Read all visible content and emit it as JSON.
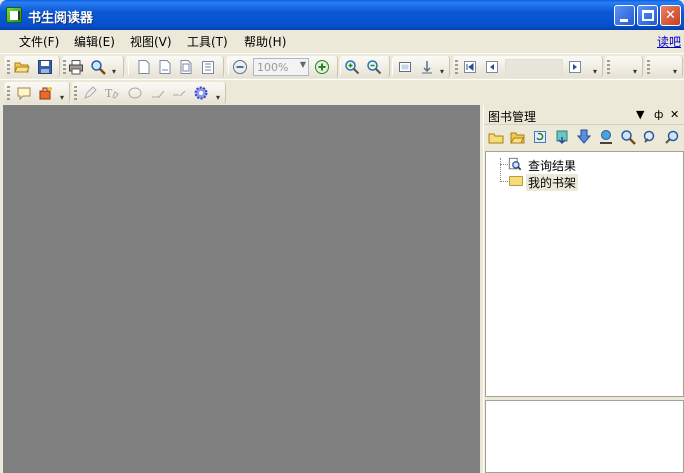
{
  "window": {
    "title": "书生阅读器",
    "controls": {
      "minimize": "",
      "maximize": "",
      "close": "✕"
    }
  },
  "menubar": {
    "items": [
      {
        "label": "文件(F)"
      },
      {
        "label": "编辑(E)"
      },
      {
        "label": "视图(V)"
      },
      {
        "label": "工具(T)"
      },
      {
        "label": "帮助(H)"
      }
    ],
    "right_link": "读吧"
  },
  "toolbar": {
    "zoom_value": "100%",
    "page_value": "",
    "icons": [
      "open-folder-icon",
      "save-icon",
      "print-icon",
      "find-icon",
      "single-page-icon",
      "continuous-page-icon",
      "facing-page-icon",
      "continuous-facing-icon",
      "zoom-out-icon",
      "zoom-in-icon",
      "zoom-magnify-icon",
      "zoom-reduce-icon",
      "fit-page-icon",
      "fit-width-icon",
      "first-page-icon",
      "previous-page-icon",
      "next-page-icon"
    ]
  },
  "annotation_toolbar": {
    "icons": [
      "comment-icon",
      "stamp-icon",
      "pencil-icon",
      "text-tool-icon",
      "ellipse-tool-icon",
      "line-tool-icon",
      "settings-gear-icon"
    ]
  },
  "panel": {
    "title": "图书管理",
    "header_buttons": {
      "dropdown": "▼",
      "pin": "ф",
      "close": "✕"
    },
    "tools": [
      "new-book-icon",
      "open-book-icon",
      "refresh-icon",
      "import-icon",
      "download-icon",
      "online-icon",
      "search-icon",
      "search-next-icon",
      "search-web-icon"
    ],
    "tree": [
      {
        "label": "查询结果",
        "icon": "search-result-icon"
      },
      {
        "label": "我的书架",
        "icon": "folder-icon",
        "selected": true
      }
    ]
  },
  "colors": {
    "titlebar": "#0a5fe0",
    "content_bg": "#808080",
    "chrome": "#ece9d8",
    "link": "#0000cc"
  }
}
